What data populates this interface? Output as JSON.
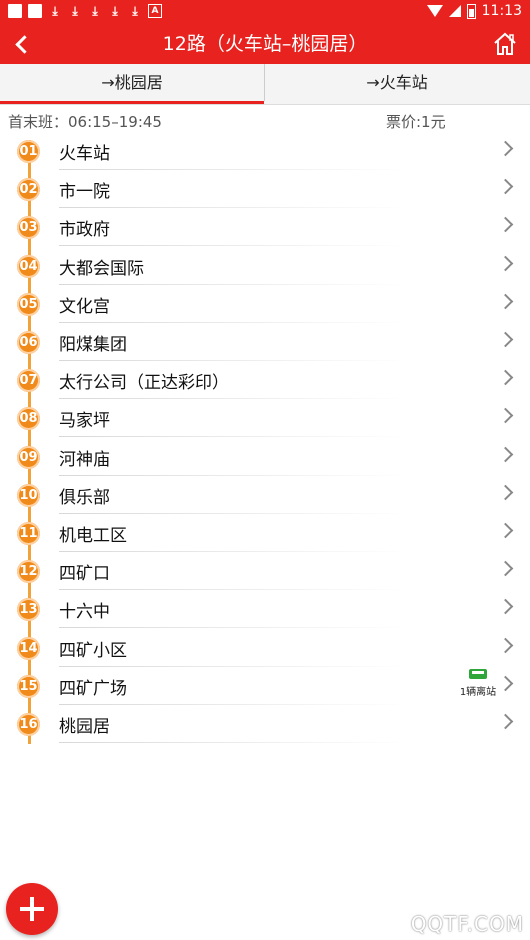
{
  "status_bar": {
    "time": "11:13",
    "icons": [
      "square-icon",
      "square-icon",
      "download-icon",
      "download-icon",
      "download-icon",
      "download-icon",
      "download-icon",
      "a-icon",
      "wifi-icon",
      "signal-icon",
      "battery-icon"
    ]
  },
  "header": {
    "title": "12路（火车站–桃园居）",
    "back_icon": "back-icon",
    "home_icon": "home-icon"
  },
  "tabs": [
    {
      "label": "→桃园居",
      "active": true
    },
    {
      "label": "→火车站",
      "active": false
    }
  ],
  "route_info": {
    "schedule": "首末班：06:15–19:45",
    "fare": "票价:1元"
  },
  "stations": [
    {
      "num": "01",
      "name": "火车站"
    },
    {
      "num": "02",
      "name": "市一院"
    },
    {
      "num": "03",
      "name": "市政府"
    },
    {
      "num": "04",
      "name": "大都会国际"
    },
    {
      "num": "05",
      "name": "文化宫"
    },
    {
      "num": "06",
      "name": "阳煤集团"
    },
    {
      "num": "07",
      "name": "太行公司（正达彩印）"
    },
    {
      "num": "08",
      "name": "马家坪"
    },
    {
      "num": "09",
      "name": "河神庙"
    },
    {
      "num": "10",
      "name": "俱乐部"
    },
    {
      "num": "11",
      "name": "机电工区"
    },
    {
      "num": "12",
      "name": "四矿口"
    },
    {
      "num": "13",
      "name": "十六中"
    },
    {
      "num": "14",
      "name": "四矿小区"
    },
    {
      "num": "15",
      "name": "四矿广场",
      "bus_text": "1辆离站"
    },
    {
      "num": "16",
      "name": "桃园居"
    }
  ],
  "colors": {
    "brand": "#e8231f",
    "badge": "#f08a1a",
    "route_line": "#f2a23a",
    "bus": "#2fa63a"
  },
  "watermark": "QQTF.COM"
}
